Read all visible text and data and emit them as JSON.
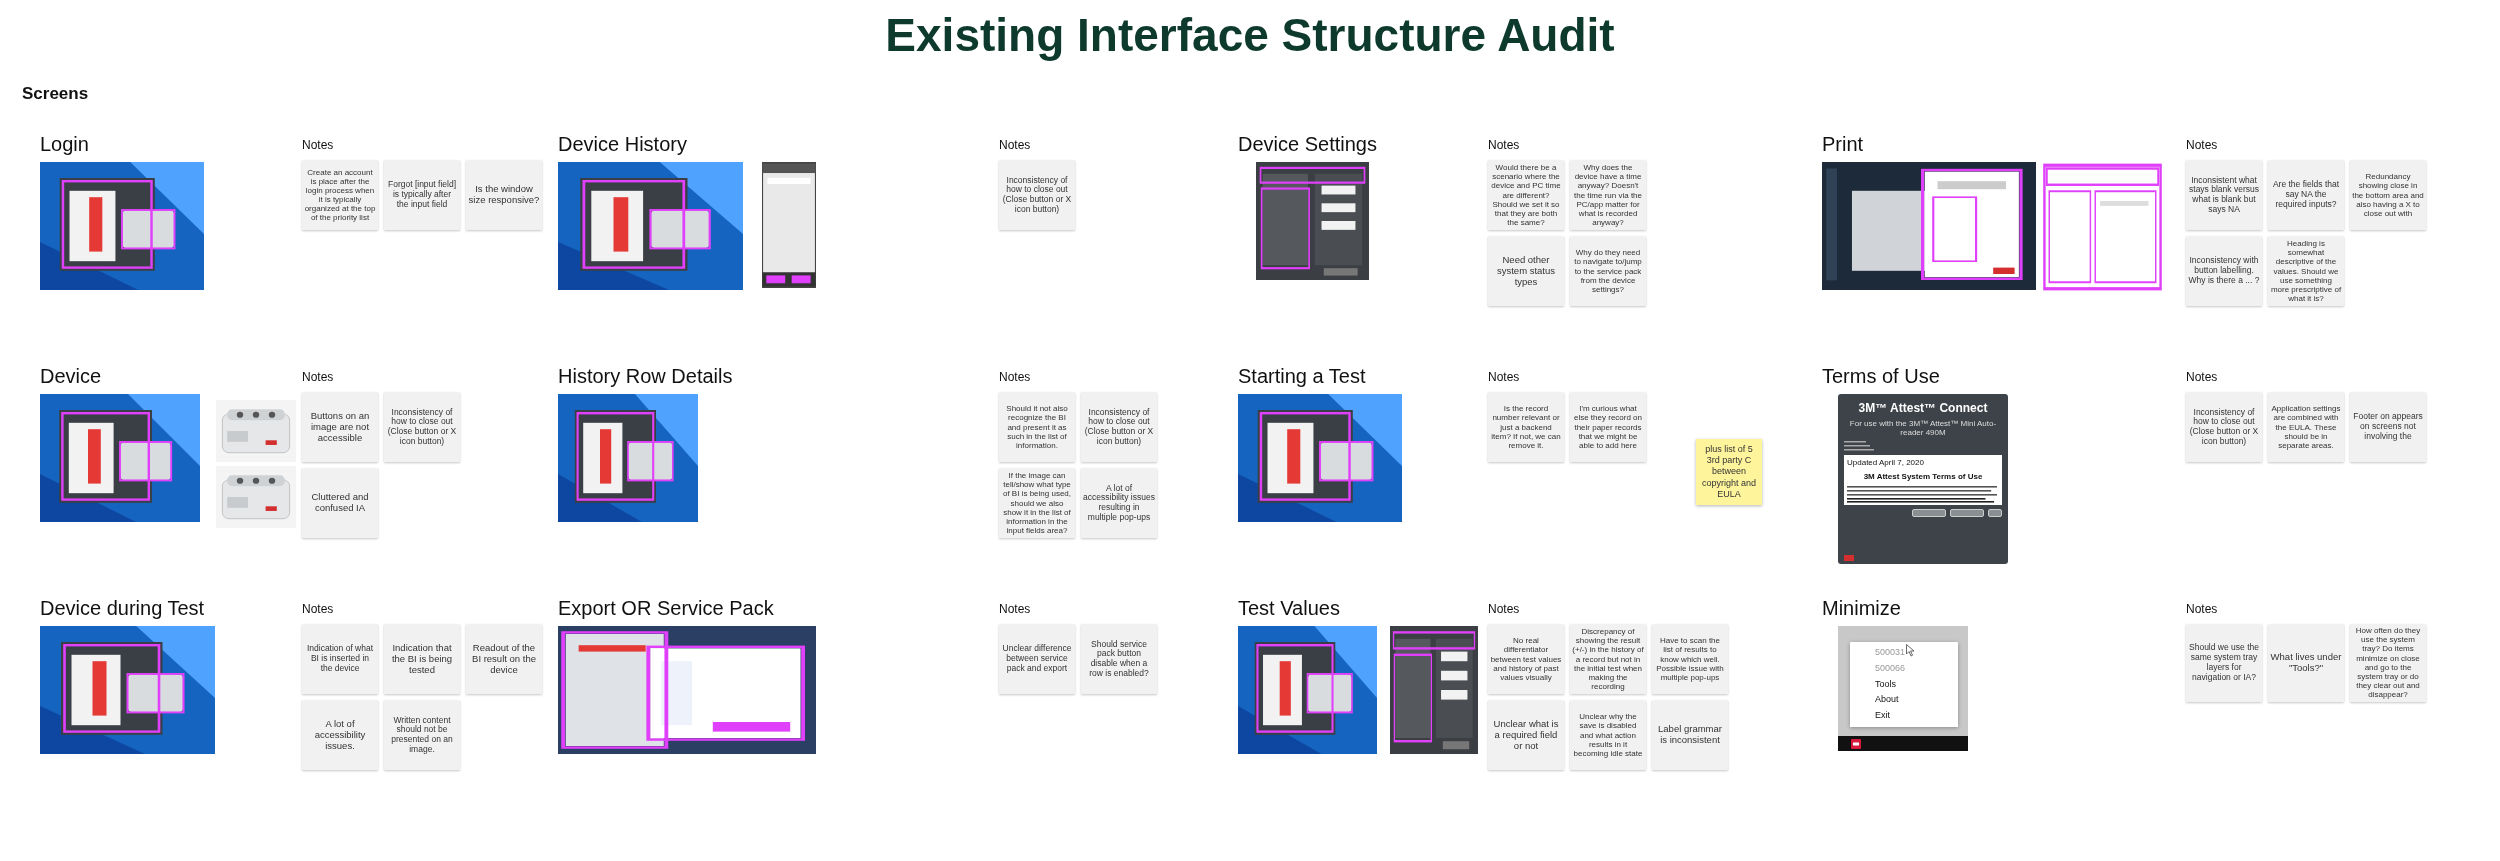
{
  "title": "Existing Interface Structure Audit",
  "group_label": "Screens",
  "sections": [
    {
      "title": "Login",
      "images": [
        {
          "kind": "picture"
        }
      ],
      "notes_heading": "Notes",
      "note_rows": [
        [
          "Create an account is place after the login process when it is typically organized at the top of the priority list",
          "Forgot [input field] is typically after the input field",
          "Is the window size responsive?"
        ]
      ]
    },
    {
      "title": "Device History",
      "images": [
        {
          "kind": "picture"
        },
        {
          "kind": "picture"
        }
      ],
      "notes_heading": "Notes",
      "note_rows": [
        [
          "Inconsistency of how to close out (Close button or X icon button)"
        ]
      ]
    },
    {
      "title": "Device Settings",
      "images": [
        {
          "kind": "picture"
        }
      ],
      "notes_heading": "Notes",
      "note_rows": [
        [
          "Would there be a scenario where the device and PC time are different? Should we set it so that they are both the same?",
          "Why does the device have a time anyway? Doesn't the time run via the PC/app matter for what is recorded anyway?"
        ],
        [
          "Need other system status types",
          "Why do they need to navigate to/jump to the service pack from the device settings?"
        ]
      ]
    },
    {
      "title": "Print",
      "images": [
        {
          "kind": "picture"
        },
        {
          "kind": "picture"
        }
      ],
      "notes_heading": "Notes",
      "note_rows": [
        [
          "Inconsistent what stays blank versus what is blank but says NA",
          "Are the fields that say NA the required inputs?",
          "Redundancy showing close in the bottom area and also having a X to close out with"
        ],
        [
          "Inconsistency with button labelling. Why is there a ... ?",
          "Heading is somewhat descriptive of the values. Should we use something more prescriptive of what it is?"
        ]
      ]
    },
    {
      "title": "Device",
      "images": [
        {
          "kind": "picture"
        },
        {
          "kind": "picture"
        },
        {
          "kind": "picture"
        }
      ],
      "notes_heading": "Notes",
      "note_rows": [
        [
          "Buttons on an image are not accessible",
          "Inconsistency of how to close out (Close button or X icon button)"
        ],
        [
          "Cluttered and confused IA"
        ]
      ]
    },
    {
      "title": "History Row Details",
      "images": [
        {
          "kind": "picture"
        }
      ],
      "notes_heading": "Notes",
      "note_rows": [
        [
          "Should it not also recognize the BI and present it as such in the list of information.",
          "Inconsistency of how to close out (Close button or X icon button)"
        ],
        [
          "If the image can tell/show what type of BI is being used, should we also show it in the list of information in the input fields area?",
          "A lot of accessibility issues resulting in multiple pop-ups"
        ]
      ]
    },
    {
      "title": "Starting a Test",
      "images": [
        {
          "kind": "picture"
        }
      ],
      "notes_heading": "Notes",
      "note_rows": [
        [
          "Is the record number relevant or just a backend item? If not, we can remove it.",
          "I'm curious what else they record on their paper records that we might be able to add here"
        ]
      ]
    },
    {
      "title": "Terms of Use",
      "sticky": "plus list of 5 3rd party C between copyright and EULA",
      "window": {
        "title": "3M™ Attest™ Connect",
        "subtitle": "For use with the 3M™ Attest™ Mini Auto-reader 490M",
        "updated": "Updated April 7, 2020",
        "heading": "3M Attest System Terms of Use"
      },
      "notes_heading": "Notes",
      "note_rows": [
        [
          "Inconsistency of how to close out (Close button or X icon button)",
          "Application settings are combined with the EULA. These should be in separate areas.",
          "Footer on appears on screens  not involving the"
        ]
      ]
    },
    {
      "title": "Device during Test",
      "images": [
        {
          "kind": "picture"
        }
      ],
      "notes_heading": "Notes",
      "note_rows": [
        [
          "Indication of what BI is inserted in the device",
          "Indication that the BI is being tested",
          "Readout of the BI result on the device"
        ],
        [
          "A lot of accessibility issues.",
          "Written content should not be presented on an image."
        ]
      ]
    },
    {
      "title": "Export OR Service Pack",
      "images": [
        {
          "kind": "picture"
        }
      ],
      "notes_heading": "Notes",
      "note_rows": [
        [
          "Unclear difference between service pack and export",
          "Should service pack button disable when a row is enabled?"
        ]
      ]
    },
    {
      "title": "Test Values",
      "images": [
        {
          "kind": "picture"
        },
        {
          "kind": "picture"
        }
      ],
      "notes_heading": "Notes",
      "note_rows": [
        [
          "No real differentiator between test values and history of past values visually",
          "Discrepancy of showing the result (+/-) in the history of a record but not in the initial test when making the recording",
          "Have to scan the list of results to know which well. Possible issue with multiple pop-ups"
        ],
        [
          "Unclear what is a required field or not",
          "Unclear why the save is disabled and what action results in it becoming idle state",
          "Label grammar is inconsistent"
        ]
      ]
    },
    {
      "title": "Minimize",
      "menu": [
        {
          "label": "500031",
          "disabled": true
        },
        {
          "label": "500066",
          "disabled": true
        },
        {
          "label": "Tools",
          "disabled": false
        },
        {
          "label": "About",
          "disabled": false
        },
        {
          "label": "Exit",
          "disabled": false
        }
      ],
      "notes_heading": "Notes",
      "note_rows": [
        [
          "Should we use the same system tray layers for navigation or IA?",
          "What lives under \"Tools?\"",
          "How often do they use the system tray? Do items minimize on close and go to the system tray or do they clear out and disappear?"
        ]
      ]
    }
  ]
}
